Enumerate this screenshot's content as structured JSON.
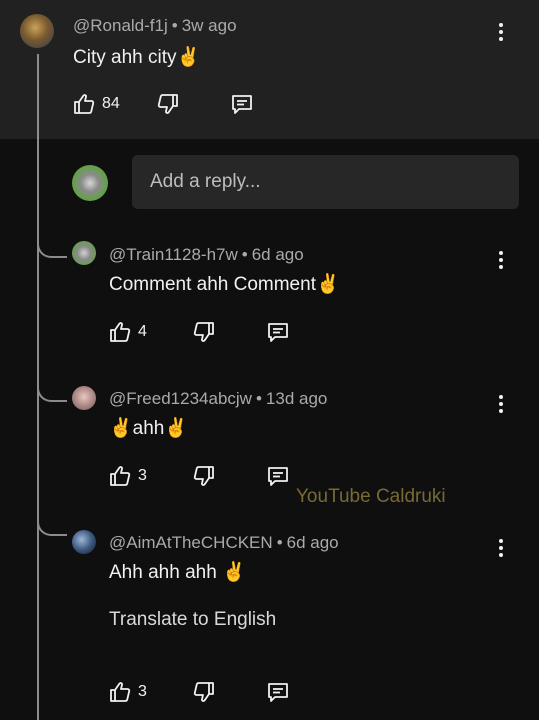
{
  "main_comment": {
    "handle": "@Ronald-f1j",
    "dot": "•",
    "time": "3w ago",
    "text": "City ahh city✌️",
    "likes": "84"
  },
  "reply_input": {
    "placeholder": "Add a reply..."
  },
  "replies": [
    {
      "handle": "@Train1128-h7w",
      "dot": "•",
      "time": "6d ago",
      "text": "Comment ahh Comment✌️",
      "likes": "4"
    },
    {
      "handle": "@Freed1234abcjw",
      "dot": "•",
      "time": "13d ago",
      "text": "✌️ahh✌️",
      "likes": "3"
    },
    {
      "handle": "@AimAtTheCHCKEN",
      "dot": "•",
      "time": "6d ago",
      "text": "Ahh ahh ahh ✌️",
      "translate": "Translate to English",
      "likes": "3"
    }
  ],
  "watermark": "YouTube Caldruki",
  "colors": {
    "background": "#0f0f0f",
    "panel": "#212121",
    "input": "#272727",
    "thread_line": "#8c8c8c"
  },
  "icons": [
    "like-icon",
    "dislike-icon",
    "reply-icon",
    "more-vert-icon"
  ]
}
